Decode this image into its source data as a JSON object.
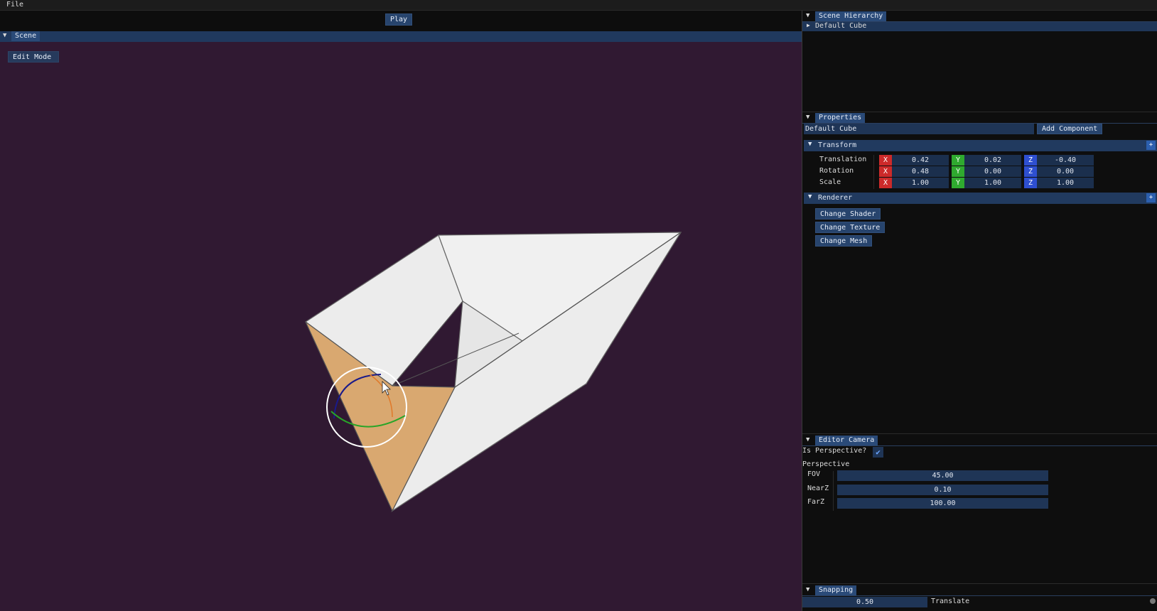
{
  "menubar": {
    "file_label": "File"
  },
  "toolbar": {
    "play_label": "Play"
  },
  "scene": {
    "tab_label": "Scene",
    "mode_label": "Edit Mode"
  },
  "hierarchy": {
    "tab_label": "Scene Hierarchy",
    "items": [
      "Default Cube"
    ]
  },
  "properties": {
    "tab_label": "Properties",
    "object_name": "Default Cube",
    "add_component_label": "Add Component",
    "transform": {
      "header": "Transform",
      "rows": [
        {
          "label": "Translation",
          "x": "0.42",
          "y": "0.02",
          "z": "-0.40"
        },
        {
          "label": "Rotation",
          "x": "0.48",
          "y": "0.00",
          "z": "0.00"
        },
        {
          "label": "Scale",
          "x": "1.00",
          "y": "1.00",
          "z": "1.00"
        }
      ]
    },
    "renderer": {
      "header": "Renderer",
      "buttons": [
        "Change Shader",
        "Change Texture",
        "Change Mesh"
      ]
    },
    "axis_labels": {
      "x": "X",
      "y": "Y",
      "z": "Z"
    },
    "plus_label": "+"
  },
  "editor_camera": {
    "tab_label": "Editor Camera",
    "is_perspective_label": "Is Perspective?",
    "is_perspective": true,
    "section_label": "Perspective",
    "fov_label": "FOV",
    "fov_value": "45.00",
    "nearz_label": "NearZ",
    "nearz_value": "0.10",
    "farz_label": "FarZ",
    "farz_value": "100.00"
  },
  "snapping": {
    "tab_label": "Snapping",
    "value": "0.50",
    "mode_label": "Translate"
  },
  "colors": {
    "scene_bg": "#301932",
    "header_blue": "#213a5f",
    "face_orange": "#d9a870",
    "face_white": "#ececec"
  }
}
